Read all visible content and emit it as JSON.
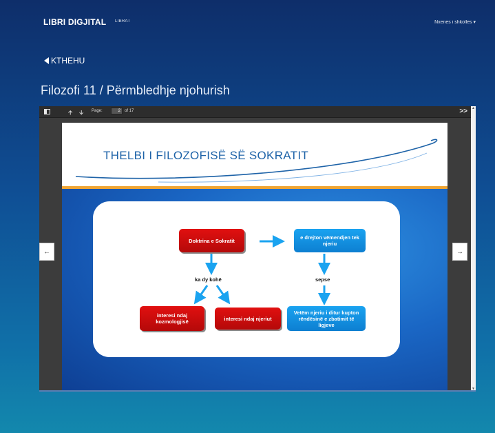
{
  "header": {
    "brand": "LIBRI DIGJITAL",
    "nav_librat": "LIBRAT",
    "user_menu": "Nxenes i shkolles ▾"
  },
  "back": {
    "label": "KTHEHU"
  },
  "page_title": "Filozofi 11 / Përmbledhje njohurish",
  "viewer": {
    "page_label": "Page:",
    "current_page": "2",
    "total_pages": "of 17",
    "more_icon": ">>"
  },
  "slide": {
    "title": "THELBI I FILOZOFISË SË SOKRATIT",
    "boxes": {
      "doctrine": "Doktrina e Sokratit",
      "directs": "e drejton vëmendjen tek njeriu",
      "cosmology": "interesi ndaj kozmologjisë",
      "man": "interesi ndaj njeriut",
      "only_man": "Vetëm njeriu i ditur kupton rëndësinë e zbatimit të ligjeve"
    },
    "labels": {
      "two_times": "ka dy kohë",
      "because": "sepse"
    }
  },
  "colors": {
    "accent_blue": "#1e63a8",
    "box_red": "#e11010",
    "box_blue": "#1aa3f0",
    "orange_rule": "#f0a533"
  }
}
